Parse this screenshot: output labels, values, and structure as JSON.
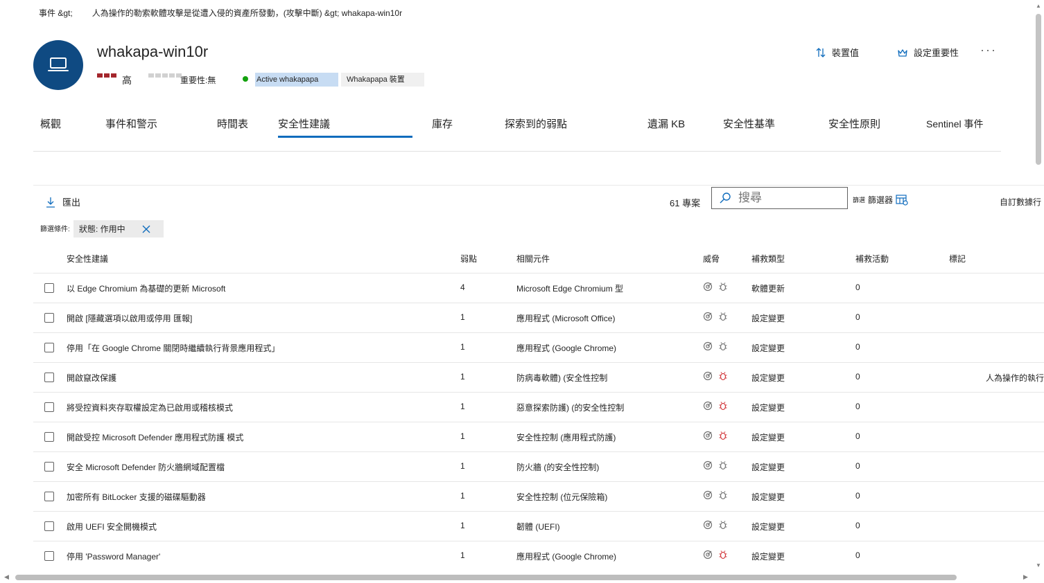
{
  "breadcrumb": {
    "part1": "事件 &gt;",
    "part2": "人為操作的勒索軟體攻擊是從遭入侵的資產所發動，(攻擊中斷) &gt; whakapa-win10r"
  },
  "device": {
    "name": "whakapa-win10r",
    "risk_label": "高",
    "criticality_label": "重要性:無",
    "tag_active": "Active whakapapa",
    "tag_device": "Whakapapa 裝置"
  },
  "actions": {
    "device_value": "裝置值",
    "set_criticality": "設定重要性",
    "more": "···"
  },
  "tabs": [
    "概觀",
    "事件和警示",
    "時間表",
    "安全性建議",
    "庫存",
    "探索到的弱點",
    "遺漏 KB",
    "安全性基準",
    "安全性原則",
    "Sentinel 事件"
  ],
  "toolbar": {
    "export": "匯出",
    "count": "61 專案",
    "search_placeholder": "搜尋",
    "filter_small": "篩選",
    "filter": "篩選器",
    "customize": "自訂數據行"
  },
  "filters": {
    "label": "篩選條件:",
    "chip": "狀態: 作用中"
  },
  "columns": {
    "recommendation": "安全性建議",
    "weaknesses": "弱點",
    "component": "相關元件",
    "threats": "威脅",
    "remediation_type": "補救類型",
    "remediation_activities": "補救活動",
    "tags": "標記"
  },
  "rows": [
    {
      "recommendation": "以 Edge Chromium 為基礎的更新 Microsoft",
      "weaknesses": "4",
      "component": "Microsoft Edge Chromium 型",
      "remediation_type": "軟體更新",
      "activities": "0",
      "tag": "",
      "bug_active": false
    },
    {
      "recommendation": "開啟 [隱藏選項以啟用或停用 匯報]",
      "weaknesses": "1",
      "component": "應用程式 (Microsoft Office)",
      "remediation_type": "設定變更",
      "activities": "0",
      "tag": "",
      "bug_active": false
    },
    {
      "recommendation": "停用「在 Google Chrome 關閉時繼續執行背景應用程式」",
      "weaknesses": "1",
      "component": "應用程式 (Google Chrome)",
      "remediation_type": "設定變更",
      "activities": "0",
      "tag": "",
      "bug_active": false
    },
    {
      "recommendation": "開啟竄改保護",
      "weaknesses": "1",
      "component": "防病毒軟體) (安全性控制",
      "remediation_type": "設定變更",
      "activities": "0",
      "tag": "人為操作的執行",
      "bug_active": true
    },
    {
      "recommendation": "將受控資料夾存取權設定為已啟用或稽核模式",
      "weaknesses": "1",
      "component": "惡意探索防護) (的安全性控制",
      "remediation_type": "設定變更",
      "activities": "0",
      "tag": "",
      "bug_active": true
    },
    {
      "recommendation": "開啟受控 Microsoft Defender 應用程式防護 模式",
      "weaknesses": "1",
      "component": "安全性控制 (應用程式防護)",
      "remediation_type": "設定變更",
      "activities": "0",
      "tag": "",
      "bug_active": true
    },
    {
      "recommendation": "安全 Microsoft Defender 防火牆網域配置檔",
      "weaknesses": "1",
      "component": "防火牆 (的安全性控制)",
      "remediation_type": "設定變更",
      "activities": "0",
      "tag": "",
      "bug_active": false
    },
    {
      "recommendation": "加密所有 BitLocker 支援的磁碟驅動器",
      "weaknesses": "1",
      "component": "安全性控制 (位元保險箱)",
      "remediation_type": "設定變更",
      "activities": "0",
      "tag": "",
      "bug_active": false
    },
    {
      "recommendation": "啟用 UEFI 安全開機模式",
      "weaknesses": "1",
      "component": "韌體 (UEFI)",
      "remediation_type": "設定變更",
      "activities": "0",
      "tag": "",
      "bug_active": false
    },
    {
      "recommendation": "停用 'Password Manager'",
      "weaknesses": "1",
      "component": "應用程式 (Google Chrome)",
      "remediation_type": "設定變更",
      "activities": "0",
      "tag": "",
      "bug_active": true
    }
  ],
  "colors": {
    "accent": "#0f6cbd",
    "avatar": "#0f4a82",
    "risk_high": "#a4262c",
    "status_dot": "#13a10e",
    "bug_active": "#d13438",
    "icon_gray": "#707070"
  }
}
